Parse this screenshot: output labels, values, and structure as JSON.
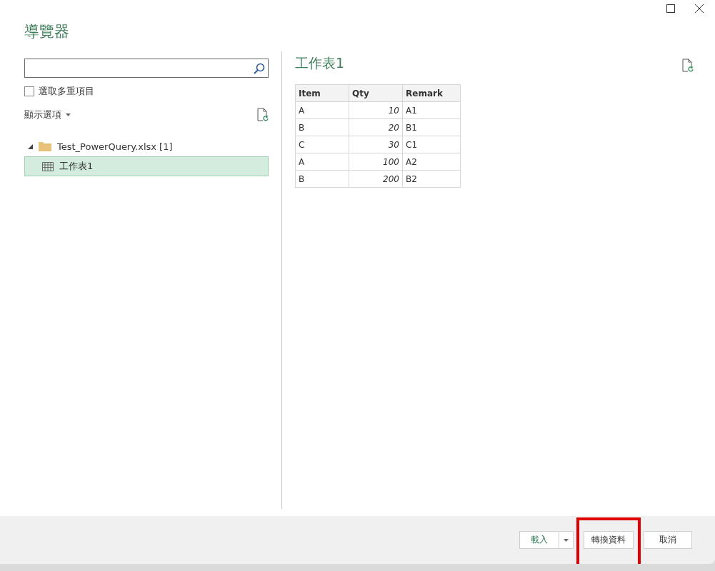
{
  "window": {
    "title": "導覽器"
  },
  "multi_select": {
    "label": "選取多重項目",
    "checked": false
  },
  "display_options": {
    "label": "顯示選項"
  },
  "tree": [
    {
      "label": "Test_PowerQuery.xlsx [1]",
      "expanded": true,
      "selected": false,
      "children": [
        {
          "label": "工作表1",
          "selected": true
        }
      ]
    }
  ],
  "preview": {
    "title": "工作表1",
    "table": {
      "columns": [
        "Item",
        "Qty",
        "Remark"
      ],
      "rows": [
        [
          "A",
          "10",
          "A1"
        ],
        [
          "B",
          "20",
          "B1"
        ],
        [
          "C",
          "30",
          "C1"
        ],
        [
          "A",
          "100",
          "A2"
        ],
        [
          "B",
          "200",
          "B2"
        ]
      ]
    }
  },
  "buttons": [
    {
      "label": "載入",
      "kind": "split",
      "highlighted": false
    },
    {
      "label": "轉換資料",
      "kind": "plain",
      "highlighted": true
    },
    {
      "label": "取消",
      "kind": "plain",
      "highlighted": false
    }
  ]
}
